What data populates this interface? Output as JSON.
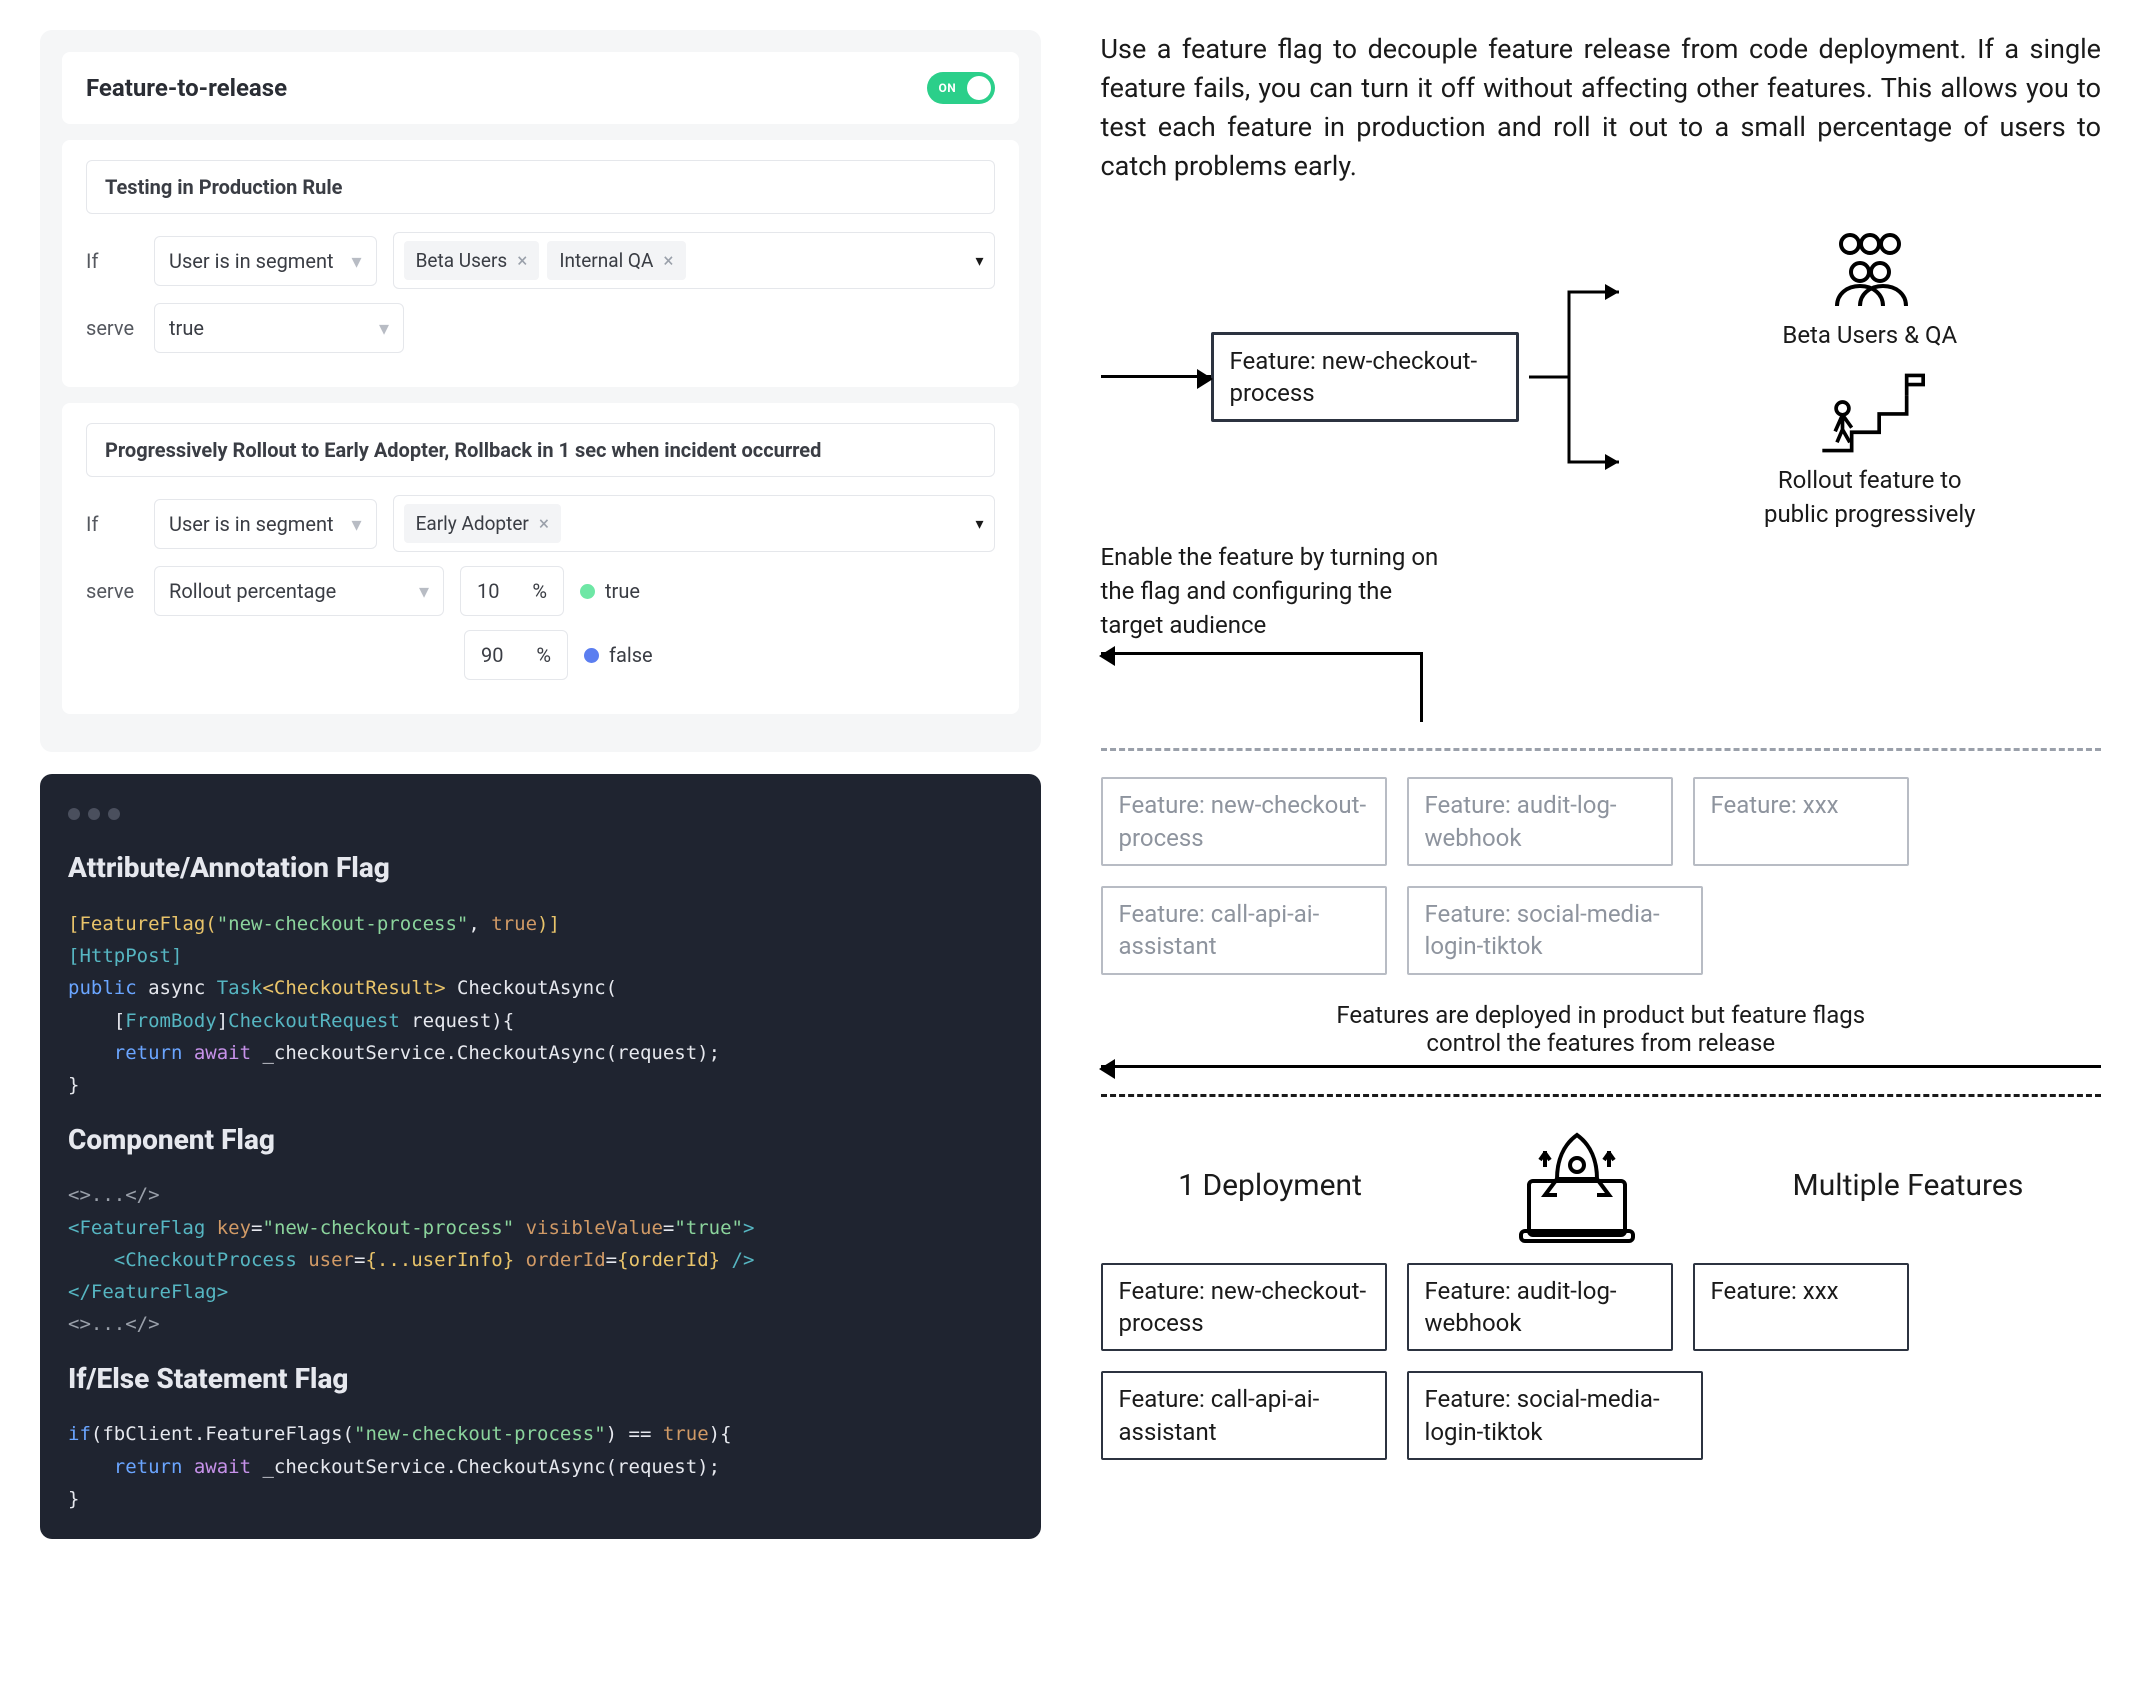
{
  "panel": {
    "header": {
      "title": "Feature-to-release",
      "toggle_label": "ON"
    },
    "rule1": {
      "title": "Testing in Production Rule",
      "if_label": "If",
      "condition": "User is in segment",
      "chips": [
        "Beta Users",
        "Internal QA"
      ],
      "serve_label": "serve",
      "serve_value": "true"
    },
    "rule2": {
      "title": "Progressively Rollout to Early Adopter, Rollback in 1 sec when incident occurred",
      "if_label": "If",
      "condition": "User is in segment",
      "chips": [
        "Early Adopter"
      ],
      "serve_label": "serve",
      "serve_mode": "Rollout percentage",
      "opts": [
        {
          "pct": "10",
          "unit": "%",
          "label": "true"
        },
        {
          "pct": "90",
          "unit": "%",
          "label": "false"
        }
      ]
    }
  },
  "code": {
    "h1": "Attribute/Annotation Flag",
    "attr1a": "[FeatureFlag(",
    "attr1b": "\"new-checkout-process\"",
    "attr1c": ", ",
    "attr1d": "true",
    "attr1e": ")]",
    "attr2": "[HttpPost]",
    "line3a": "public",
    "line3b": " async ",
    "line3c": "Task",
    "line3d": "<CheckoutResult>",
    "line3e": " CheckoutAsync(",
    "line4a": "    [",
    "line4b": "FromBody",
    "line4c": "]",
    "line4d": "CheckoutRequest",
    "line4e": " request){",
    "line5a": "    return",
    "line5b": " await ",
    "line5c": "_checkoutService.CheckoutAsync(request);",
    "line6": "}",
    "h2": "Component Flag",
    "c1": "<>...</>",
    "c2a": "<FeatureFlag ",
    "c2b": "key",
    "c2c": "=",
    "c2d": "\"new-checkout-process\"",
    "c2e": " visibleValue",
    "c2f": "=",
    "c2g": "\"true\"",
    "c2h": ">",
    "c3a": "    <CheckoutProcess ",
    "c3b": "user",
    "c3c": "=",
    "c3d": "{...userInfo}",
    "c3e": " orderId",
    "c3f": "=",
    "c3g": "{orderId}",
    "c3h": " />",
    "c4": "</FeatureFlag>",
    "c5": "<>...</>",
    "h3": "If/Else Statement Flag",
    "i1a": "if",
    "i1b": "(fbClient.FeatureFlags(",
    "i1c": "\"new-checkout-process\"",
    "i1d": ") == ",
    "i1e": "true",
    "i1f": "){",
    "i2a": "    return",
    "i2b": " await ",
    "i2c": "_checkoutService.CheckoutAsync(request);",
    "i3": "}"
  },
  "right": {
    "intro": "Use a feature flag to decouple feature release from code deployment. If a single feature fails, you can turn it off without affecting other features. This allows you to test each feature in production and roll it out to a small percentage of users to catch problems early.",
    "feature_box": "Feature: new-checkout-process",
    "beta_label": "Beta Users & QA",
    "rollout_label": "Rollout feature to\npublic progressively",
    "enable_label": "Enable the feature by turning on\nthe flag and configuring the\ntarget audience",
    "deployed_note1": "Features are deployed in product but feature flags",
    "deployed_note2": "control the features from release",
    "one_deploy": "1 Deployment",
    "multi_feat": "Multiple Features",
    "grey_boxes": [
      "Feature: new-checkout-process",
      "Feature: audit-log-webhook",
      "Feature: xxx",
      "Feature: call-api-ai-assistant",
      "Feature: social-media-login-tiktok"
    ],
    "boxes": [
      "Feature: new-checkout-process",
      "Feature: audit-log-webhook",
      "Feature: xxx",
      "Feature: call-api-ai-assistant",
      "Feature: social-media-login-tiktok"
    ]
  }
}
